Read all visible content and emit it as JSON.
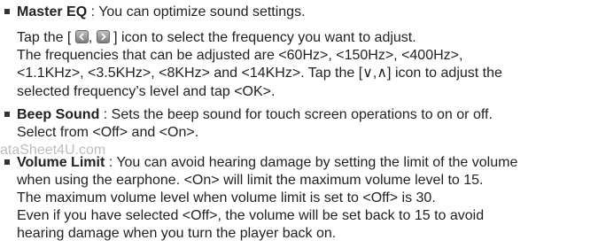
{
  "items": [
    {
      "term": "Master EQ",
      "desc": " : You can optimize sound settings.",
      "tap_pre": "Tap the [ ",
      "tap_sep": ", ",
      "tap_post": " ] icon to select the frequency you want to adjust.",
      "freq_line1": "The frequencies that can be adjusted are <60Hz>, <150Hz>, <400Hz>,",
      "freq_line2": "<1.1KHz>, <3.5KHz>, <8KHz> and <14KHz>. Tap the [∨,∧] icon to adjust the",
      "freq_line3": "selected frequency’s level and tap <OK>.",
      "icons": [
        "left-arrow-icon",
        "right-arrow-icon"
      ]
    },
    {
      "term": "Beep Sound",
      "desc": " : Sets the beep sound for touch screen operations to on or off.",
      "line2": "Select from <Off> and <On>."
    },
    {
      "term": "Volume Limit",
      "desc": " : You can avoid hearing damage by setting the limit of the volume",
      "line2": "when using the earphone. <On> will limit the maximum volume level to 15.",
      "line3": "The maximum volume level when volume limit is set to <Off> is 30.",
      "line4": "Even if you have selected <Off>, the volume will be set back to 15 to avoid",
      "line5": "hearing damage when you turn the player back on."
    }
  ],
  "watermark": "ataSheet4U.com"
}
